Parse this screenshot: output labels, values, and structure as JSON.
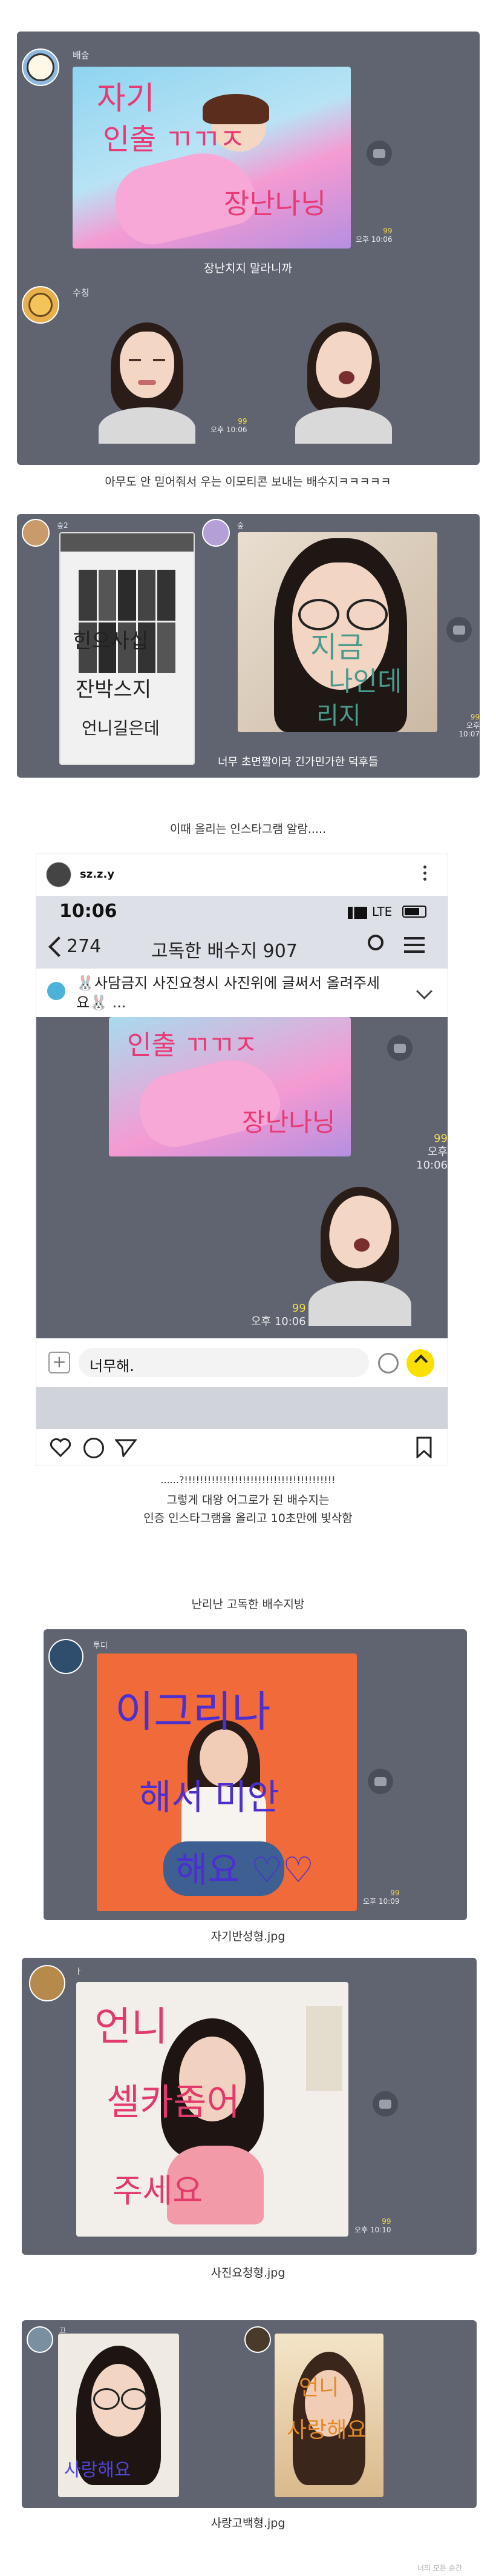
{
  "chats": {
    "top": {
      "sender1": "배숲",
      "sticker1_text": [
        "자기",
        "인출 ㄲㄲㅈ",
        "장난나닝"
      ],
      "msg1": {
        "count": "99",
        "time": "오후 10:06"
      },
      "sender2": "수칭",
      "msg2": {
        "count": "99",
        "time": "오후 10:06"
      }
    },
    "second": {
      "sender1": "숲2",
      "sender2": "숲",
      "phone_text": [
        "힌으사십",
        "잔박스지",
        "언니길은데"
      ],
      "photo_text": [
        "지금",
        "나인데",
        "리지"
      ],
      "msg": {
        "count": "99",
        "time": "오후 10:07"
      }
    }
  },
  "captions": {
    "c1": "장난치지 말라니까",
    "c2": "아무도 안 믿어줘서 우는 이모티콘 보내는 배수지ㅋㅋㅋㅋㅋ",
    "c3": "너무 초면짤이라 긴가민가한 덕후들",
    "c4": "이때 올리는 인스타그램 알람.....",
    "c5": "......?!!!!!!!!!!!!!!!!!!!!!!!!!!!!!!!!!!!!!!!",
    "c6": "그렇게 대왕 어그로가 된 배수지는",
    "c7": "인증 인스타그램을 올리고 10초만에 빛삭함",
    "c8": "난리난 고독한 배수지방",
    "c9": "자기반성형.jpg",
    "c10": "사진요청형.jpg",
    "c11": "사랑고백형.jpg"
  },
  "insta": {
    "username": "sz.z.y",
    "status_time": "10:06",
    "lte": "LTE",
    "back_count": "274",
    "room_title": "고독한 배수지 907",
    "notice": "🐰사담금지 사진요청시 사진위에 글써서 올려주세요🐰 ...",
    "sticker_text": [
      "인출 ㄲㄲㅈ",
      "장난나닝"
    ],
    "msg1": {
      "count": "99",
      "time": "오후 10:06"
    },
    "msg2": {
      "count": "99",
      "time": "오후 10:06"
    },
    "input_text": "너무해."
  },
  "chats2": {
    "p1": {
      "sender": "투디",
      "overlay": [
        "이그리나",
        "해서 미안",
        "해요 ♡♡"
      ],
      "count": "99",
      "time": "오후 10:09"
    },
    "p2": {
      "sender": "ㅏ",
      "overlay": [
        "언니",
        "셀카좀어",
        "주세요"
      ],
      "count": "99",
      "time": "오후 10:10"
    },
    "p3": {
      "sender1": "끄",
      "overlay1": [
        "사랑해요"
      ],
      "sender2": "",
      "overlay2": [
        "언니",
        "사랑해요"
      ]
    }
  },
  "watermark": "너의 모든 순간",
  "colors": {
    "chat_bg": "#5f6470",
    "count": "#f2d94a",
    "kakao_yellow": "#f9e000"
  }
}
